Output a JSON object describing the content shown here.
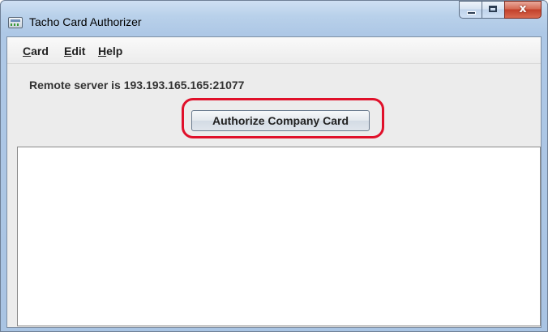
{
  "window": {
    "title": "Tacho Card Authorizer",
    "close_glyph": "x"
  },
  "menubar": {
    "items": [
      {
        "mnemonic": "C",
        "rest": "ard"
      },
      {
        "mnemonic": "E",
        "rest": "dit"
      },
      {
        "mnemonic": "H",
        "rest": "elp"
      }
    ]
  },
  "main": {
    "server_status": "Remote server is 193.193.165.165:21077",
    "authorize_button_label": "Authorize Company Card",
    "output_text": ""
  },
  "colors": {
    "highlight_ring": "#e0102a",
    "close_button": "#c2402a"
  },
  "icons": [
    "app-icon",
    "minimize-icon",
    "maximize-icon",
    "close-icon"
  ]
}
